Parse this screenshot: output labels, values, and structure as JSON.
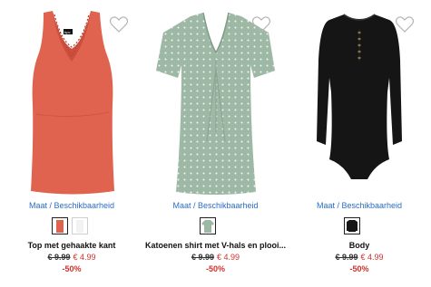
{
  "colors": {
    "link": "#2b6cc4",
    "sale": "#d0312d",
    "coral": "#e0634f",
    "sage": "#9db8a4",
    "black": "#151515"
  },
  "products": [
    {
      "size_link": "Maat / Beschikbaarheid",
      "name": "Top met gehaakte kant",
      "old_price": "€ 9.99",
      "new_price": "€ 4.99",
      "discount": "-50%",
      "image": "coral-lace-tank-top",
      "label": "bpc"
    },
    {
      "size_link": "Maat / Beschikbaarheid",
      "name": "Katoenen shirt met V-hals en plooi...",
      "old_price": "€ 9.99",
      "new_price": "€ 4.99",
      "discount": "-50%",
      "image": "sage-polka-dot-shirt"
    },
    {
      "size_link": "Maat / Beschikbaarheid",
      "name": "Body",
      "old_price": "€ 9.99",
      "new_price": "€ 4.99",
      "discount": "-50%",
      "image": "black-long-sleeve-body"
    }
  ]
}
